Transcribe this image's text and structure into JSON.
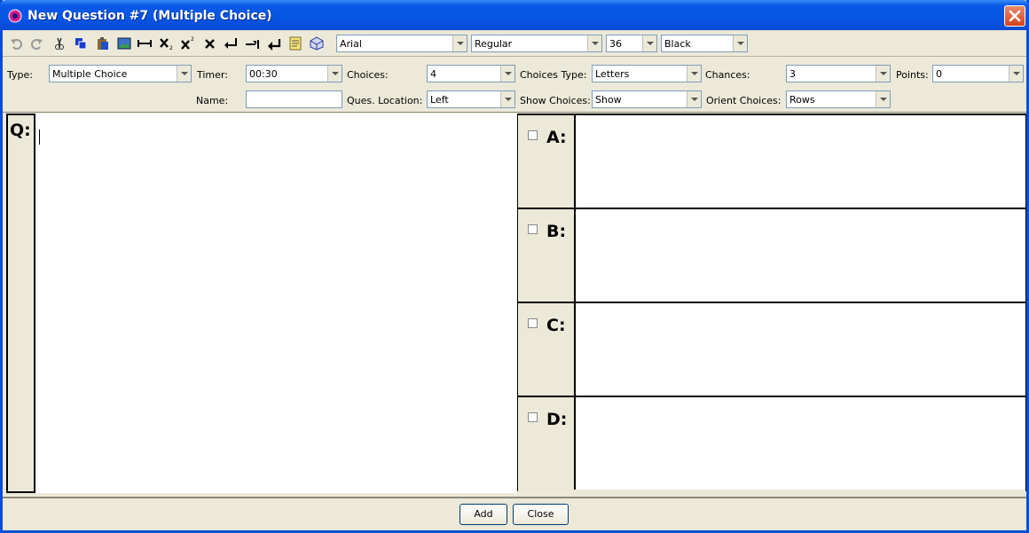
{
  "window": {
    "title": "New Question #7 (Multiple Choice)"
  },
  "toolbar": {
    "icons": [
      "undo-icon",
      "redo-icon",
      "cut-icon",
      "copy-icon",
      "paste-icon",
      "image-icon",
      "line-icon",
      "subscript-icon",
      "superscript-icon",
      "clear-format-icon",
      "return-icon",
      "tab-icon",
      "enter-icon",
      "note-icon",
      "cube-icon"
    ],
    "font": "Arial",
    "style": "Regular",
    "size": "36",
    "color": "Black"
  },
  "settings": {
    "type_label": "Type:",
    "type_value": "Multiple Choice",
    "timer_label": "Timer:",
    "timer_value": "00:30",
    "choices_label": "Choices:",
    "choices_value": "4",
    "choices_type_label": "Choices Type:",
    "choices_type_value": "Letters",
    "chances_label": "Chances:",
    "chances_value": "3",
    "points_label": "Points:",
    "points_value": "0",
    "name_label": "Name:",
    "name_value": "",
    "ques_location_label": "Ques. Location:",
    "ques_location_value": "Left",
    "show_choices_label": "Show Choices:",
    "show_choices_value": "Show",
    "orient_choices_label": "Orient Choices:",
    "orient_choices_value": "Rows"
  },
  "question": {
    "label": "Q:"
  },
  "choices": [
    {
      "label": "A:"
    },
    {
      "label": "B:"
    },
    {
      "label": "C:"
    },
    {
      "label": "D:"
    }
  ],
  "buttons": {
    "add": "Add",
    "close": "Close"
  },
  "colors": {
    "titlebar": "#0a58e6",
    "close": "#d4431e",
    "frame": "#ece9d8"
  }
}
